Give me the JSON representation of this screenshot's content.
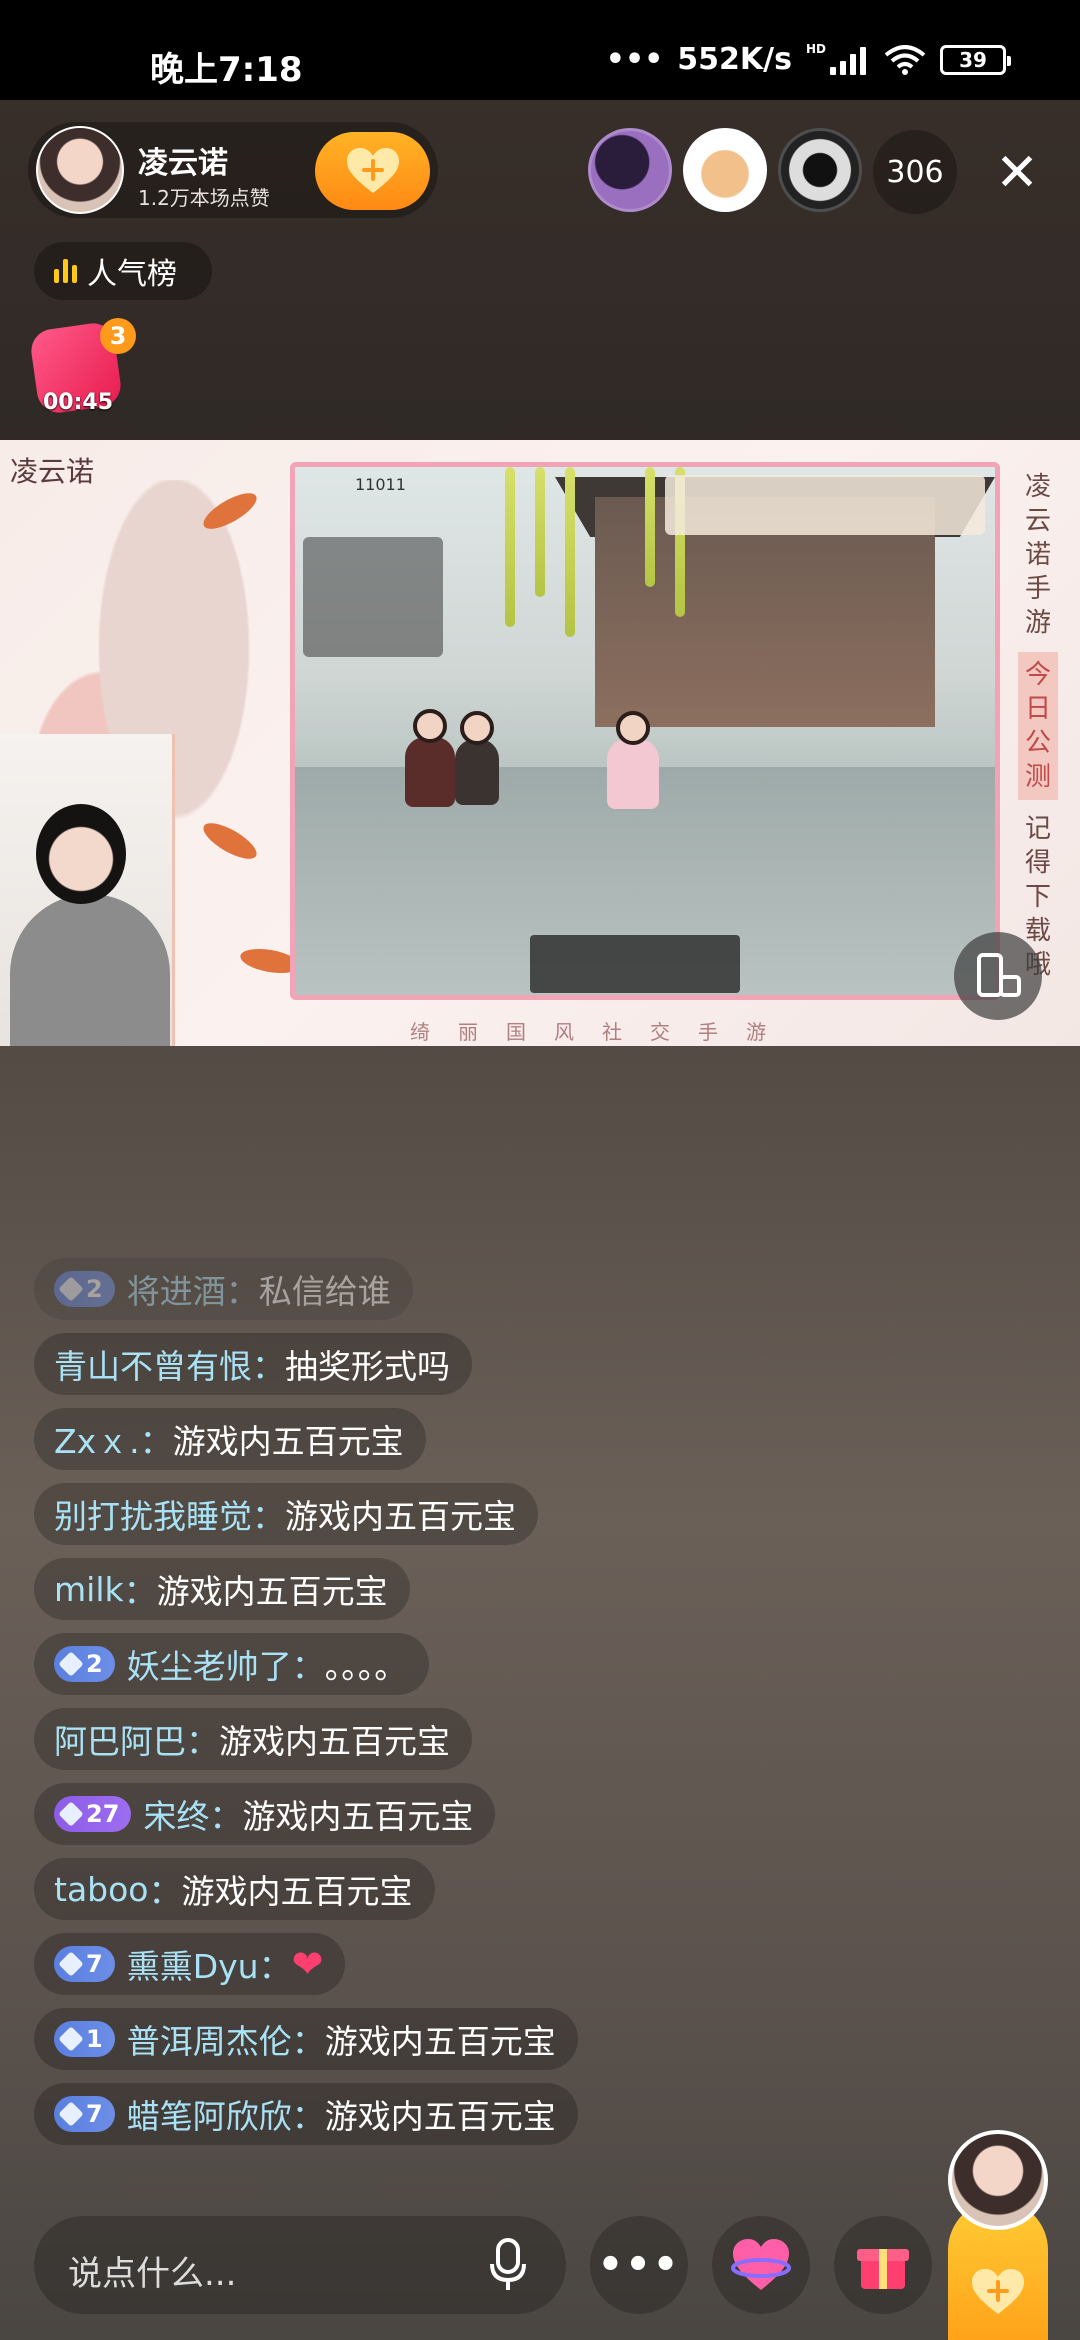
{
  "status_bar": {
    "time": "晚上7:18",
    "network_speed": "552K/s",
    "network_prefix": "•••",
    "hd_label": "HD",
    "battery": "39"
  },
  "host": {
    "name": "凌云诺",
    "likes": "1.2万本场点赞",
    "follow_icon": "heart-plus-icon"
  },
  "viewers": {
    "count": "306"
  },
  "rank": {
    "label": "人气榜"
  },
  "red_packet": {
    "badge": "3",
    "timer": "00:45"
  },
  "stream": {
    "logo": "凌云诺",
    "side_text_top": "凌云诺手游",
    "side_text_highlight": "今日公测",
    "side_text_bottom": "记得下载哦",
    "slogan": "绮丽国风社交手游",
    "game_level": "11011"
  },
  "comments": [
    {
      "badge": "2",
      "badge_type": "blue",
      "user": "将进酒",
      "text": "私信给谁",
      "faded": true
    },
    {
      "badge": "",
      "user": "青山不曾有恨",
      "text": "抽奖形式吗"
    },
    {
      "badge": "",
      "user": "Zxｘ.",
      "text": "游戏内五百元宝"
    },
    {
      "badge": "",
      "user": "别打扰我睡觉",
      "text": "游戏内五百元宝"
    },
    {
      "badge": "",
      "user": "milk",
      "text": "游戏内五百元宝"
    },
    {
      "badge": "2",
      "badge_type": "blue",
      "user": "妖尘老帅了",
      "text": "。。。。"
    },
    {
      "badge": "",
      "user": "阿巴阿巴",
      "text": "游戏内五百元宝"
    },
    {
      "badge": "27",
      "badge_type": "purple",
      "user": "宋终",
      "text": "游戏内五百元宝"
    },
    {
      "badge": "",
      "user": "taboo",
      "text": "游戏内五百元宝"
    },
    {
      "badge": "7",
      "badge_type": "blue",
      "user": "熏熏Dyu",
      "text": "❤"
    },
    {
      "badge": "1",
      "badge_type": "blue",
      "user": "普洱周杰伦",
      "text": "游戏内五百元宝"
    },
    {
      "badge": "7",
      "badge_type": "blue",
      "user": "蜡笔阿欣欣",
      "text": "游戏内五百元宝"
    }
  ],
  "bottom_bar": {
    "input_placeholder": "说点什么..."
  },
  "colors": {
    "username": "#a9e1f5",
    "badge_blue": "#5a7fe0",
    "badge_purple": "#8d5ce8",
    "follow_orange": "#ff8a14",
    "gold": "#ffa31a"
  }
}
